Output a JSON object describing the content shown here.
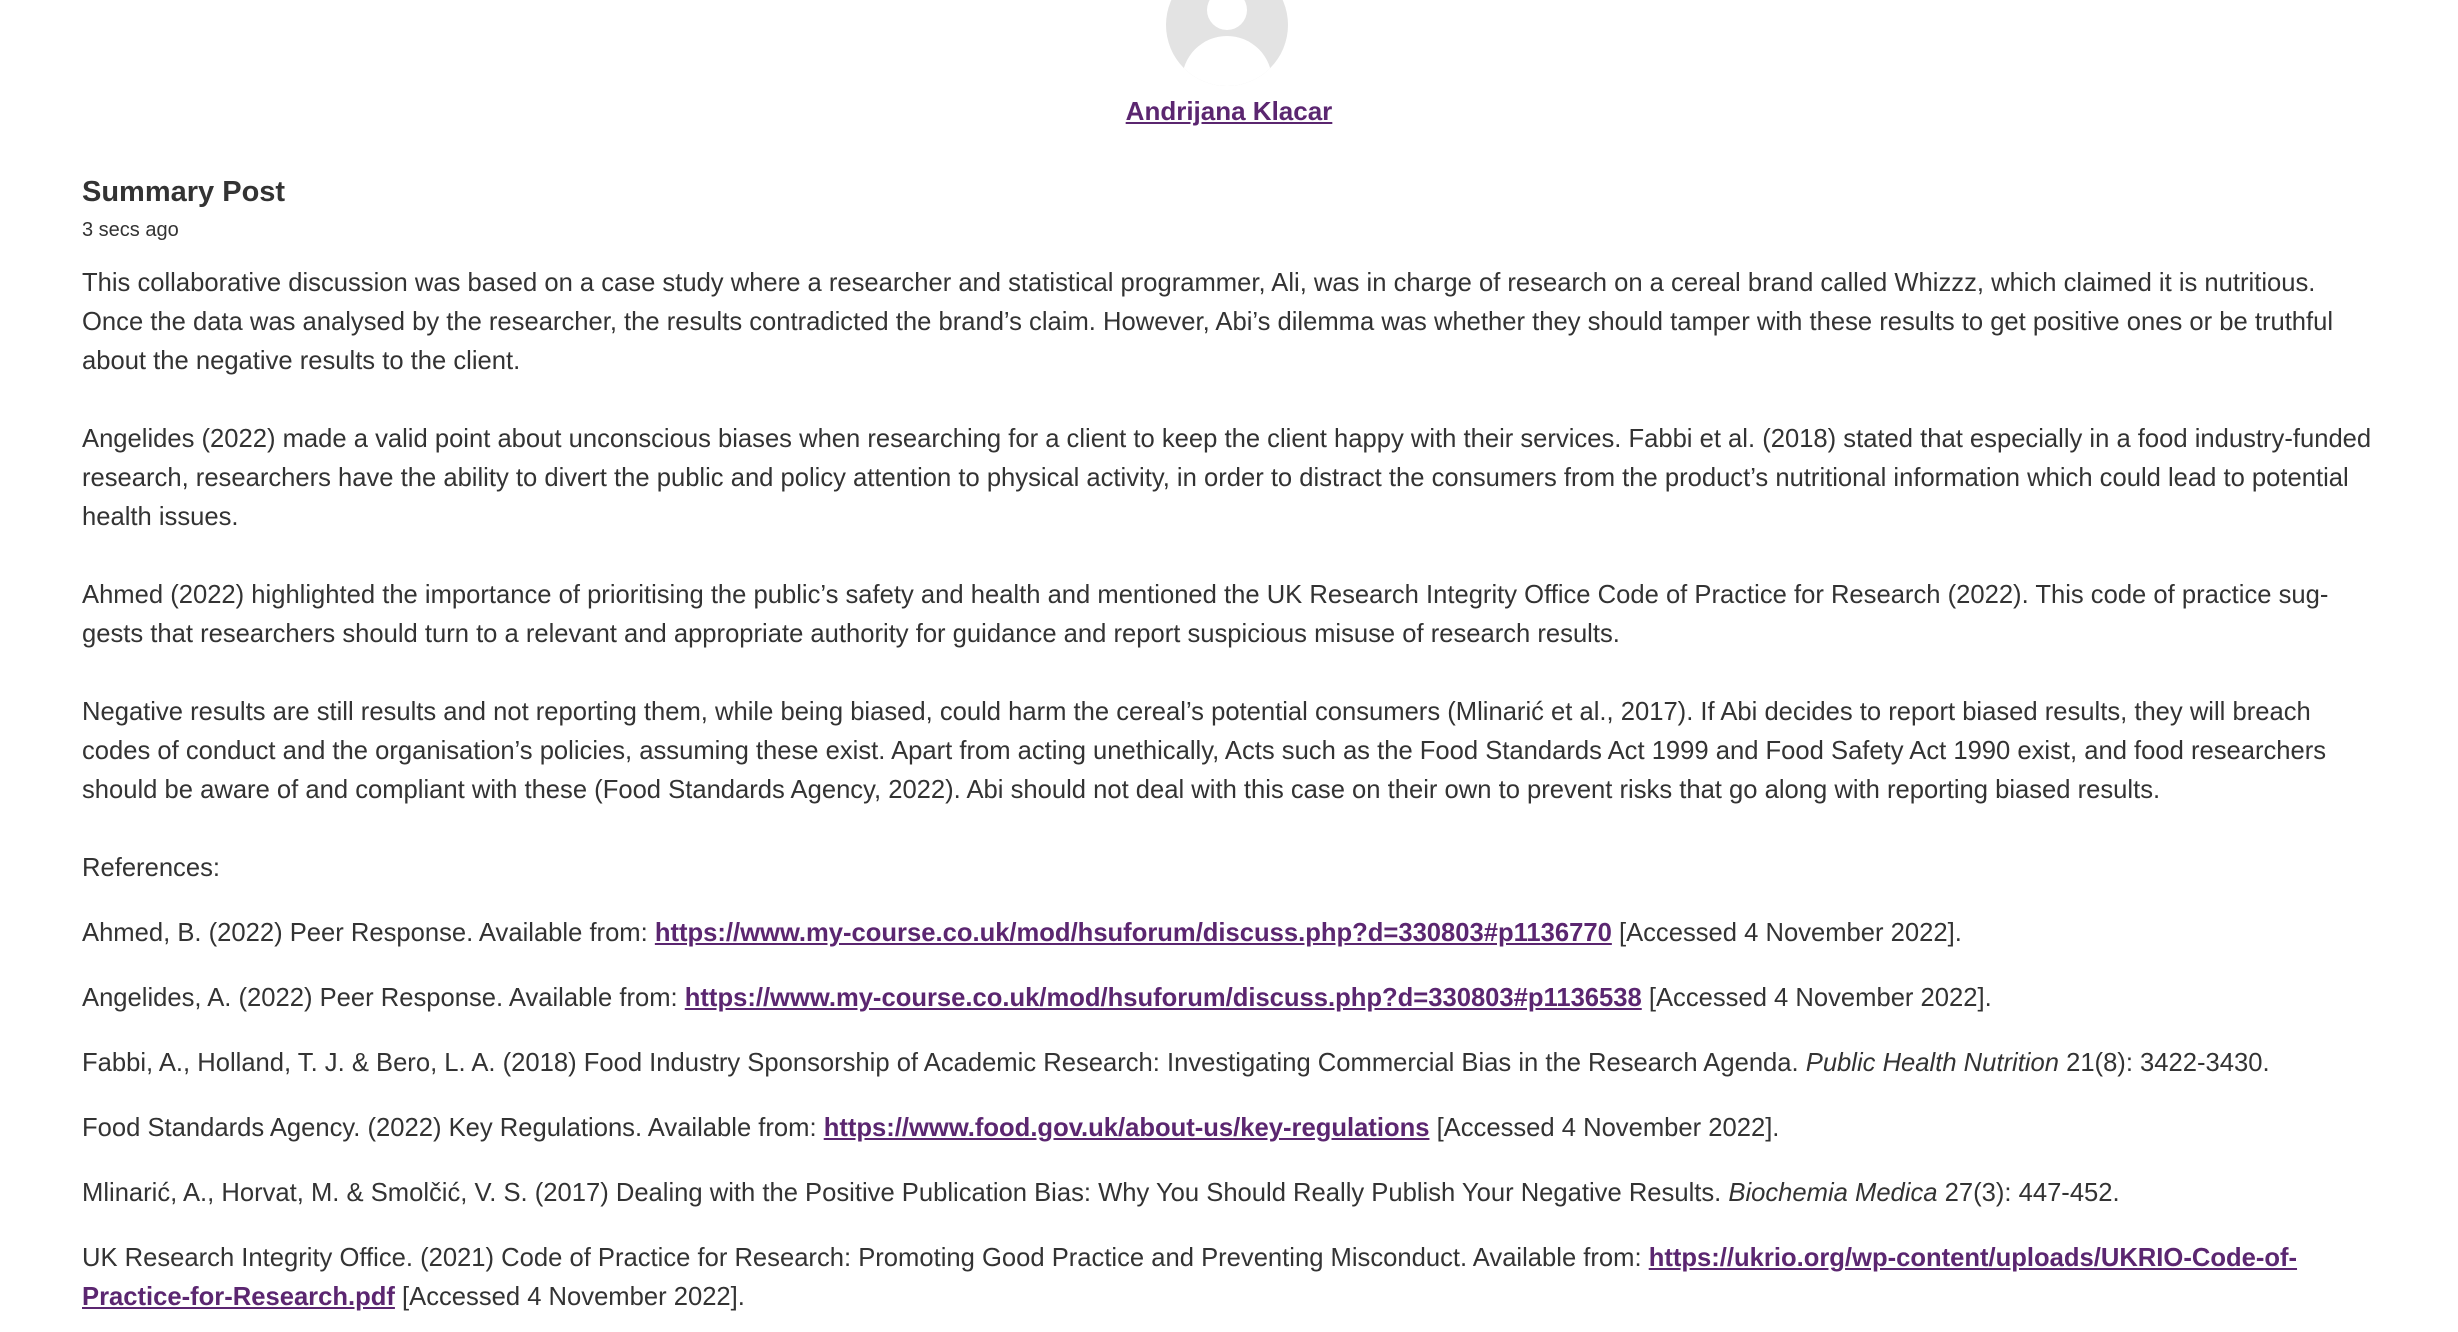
{
  "author": {
    "name": "Andrijana Klacar"
  },
  "post": {
    "title": "Summary Post",
    "time": "3 secs ago",
    "paragraphs": [
      "This collaborative discussion was based on a case study where a researcher and statistical programmer, Ali, was in charge of research on a cereal brand called Whizzz, which claimed it is nutritious. Once the data was analysed by the researcher, the results contradicted the brand’s claim. However, Abi’s dilemma was whether they should tamper with these results to get positive ones or be truthful about the negative results to the client.",
      "Angelides (2022) made a valid point about unconscious biases when researching for a client to keep the client happy with their services. Fabbi et al. (2018) stated that especially in a food industry-funded research, researchers have the ability to divert the public and policy attention to physical activity, in order to distract the consumers from the product’s nutritional information which could lead to potential health issues.",
      "Ahmed (2022) highlighted the importance of prioritising the public’s safety and health and mentioned the UK Research Integrity Office Code of Practice for Research (2022). This code of practice sug-gests that researchers should turn to a relevant and appropriate authority for guidance and report suspicious misuse of research results.",
      "Negative results are still results and not reporting them, while being biased, could harm the cereal’s potential consumers (Mlinarić et al., 2017). If Abi decides to report biased results, they will breach codes of conduct and the organisation’s policies, assuming these exist. Apart from acting unethically, Acts such as the Food Standards Act 1999 and Food Safety Act 1990 exist, and food researchers should be aware of and compliant with these (Food Standards Agency, 2022). Abi should not deal with this case on their own to prevent risks that go along with reporting biased results."
    ],
    "references_heading": "References:",
    "references": [
      {
        "text": "Ahmed, B. (2022) Peer Response. Available from: ",
        "link": "https://www.my-course.co.uk/mod/hsuforum/discuss.php?d=330803#p1136770",
        "after": " [Accessed 4 November 2022]."
      },
      {
        "text": "Angelides, A. (2022) Peer Response. Available from: ",
        "link": "https://www.my-course.co.uk/mod/hsuforum/discuss.php?d=330803#p1136538",
        "after": " [Accessed 4 November 2022]."
      },
      {
        "text": "Fabbi, A., Holland, T. J. & Bero, L. A. (2018) Food Industry Sponsorship of Academic Research: Investigating Commercial Bias in the Research Agenda. ",
        "journal": "Public Health Nutrition",
        "after": " 21(8): 3422-3430."
      },
      {
        "text": "Food Standards Agency. (2022) Key Regulations. Available from: ",
        "link": "https://www.food.gov.uk/about-us/key-regulations",
        "after": " [Accessed 4 November 2022]."
      },
      {
        "text": "Mlinarić, A., Horvat, M. & Smolčić, V. S. (2017) Dealing with the Positive Publication Bias: Why You Should Really Publish Your Negative Results. ",
        "journal": "Biochemia Medica",
        "after": " 27(3): 447-452."
      },
      {
        "text": "UK Research Integrity Office. (2021) Code of Practice for Research: Promoting Good Practice and Preventing Misconduct. Available from: ",
        "link": "https://ukrio.org/wp-content/uploads/UKRIO-Code-of-Practice-for-Research.pdf",
        "after": " [Accessed 4 November 2022]."
      }
    ]
  }
}
